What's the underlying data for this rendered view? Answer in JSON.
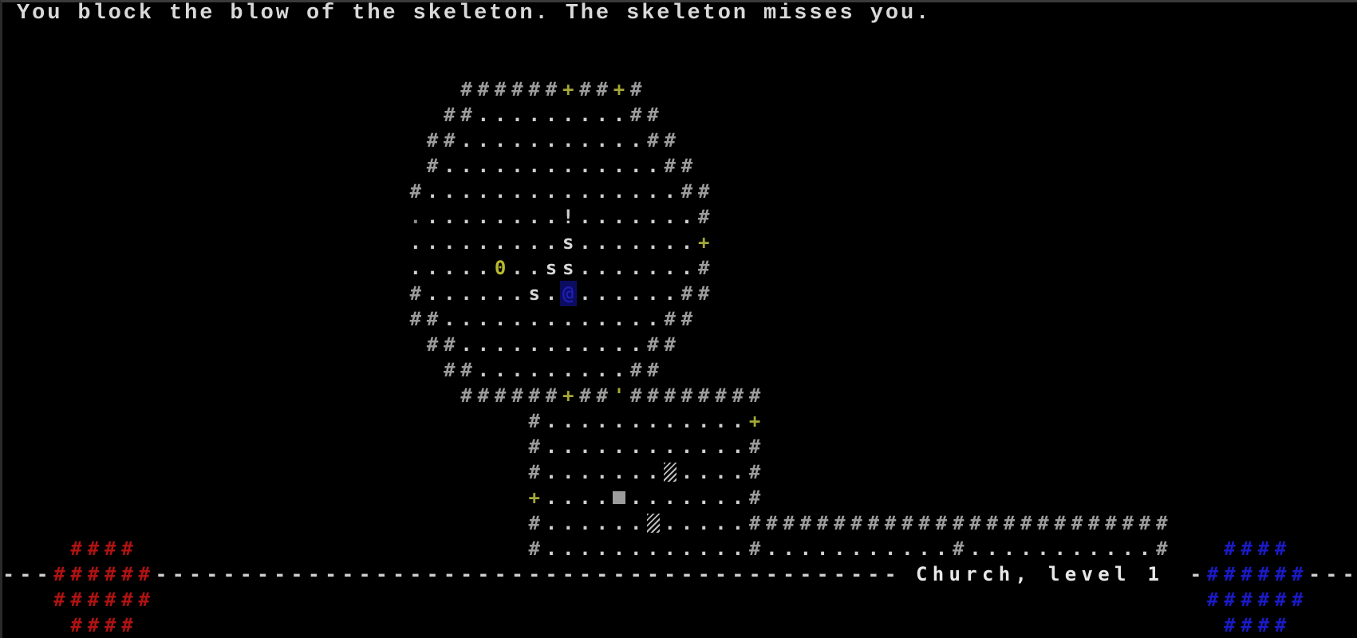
{
  "game": {
    "title": "Church, level 1",
    "message": "You block the blow of the skeleton. The skeleton misses you."
  },
  "legend": {
    "#": {
      "name": "wall",
      "color": "#9c9c9c"
    },
    ".": {
      "name": "floor",
      "color": "#cfcfcf"
    },
    "+": {
      "name": "door-closed",
      "color": "#a4a838"
    },
    "'": {
      "name": "door-open",
      "color": "#a4a838"
    },
    "!": {
      "name": "potion",
      "color": "#cfcfcf"
    },
    "0": {
      "name": "item-zero",
      "color": "#b8b830"
    },
    "s": {
      "name": "skeleton",
      "color": "#d8d8d8"
    },
    "@": {
      "name": "player",
      "color": "#1e1eb4"
    },
    "%": {
      "name": "hatched-tile",
      "color": "#bdbdbd"
    },
    "=": {
      "name": "gray-block",
      "color": "#9c9c9c"
    }
  },
  "map": {
    "first_row": 3,
    "rows": [
      "                           ######+##+#",
      "                          ##.........##",
      "                         ##...........##",
      "                         #.............##",
      "                        #...............##",
      "                        .........!.......#",
      "                        .........s.......+",
      "                        .....0..ss.......#",
      "                        #......s.@......##",
      "                        ##.............##",
      "                         ##...........##",
      "                          ##.........##",
      "                           ######+##'########",
      "                               #............+",
      "                               #............#",
      "                               #.......%....#",
      "                               +....=.......#",
      "                               #......%.....#########################",
      "                               #............#...........#...........#"
    ],
    "dim_floor": [
      [
        8,
        24
      ]
    ]
  },
  "status_bar": {
    "row": 22,
    "location": "Church, level 1",
    "location_col": 54,
    "dash_ranges": [
      [
        0,
        2
      ],
      [
        9,
        52
      ],
      [
        70,
        70
      ],
      [
        77,
        79
      ]
    ]
  },
  "health_orb": {
    "label": "health",
    "color": "#b01212",
    "rows": [
      {
        "row": 21,
        "from": 4,
        "to": 7
      },
      {
        "row": 22,
        "from": 3,
        "to": 8
      },
      {
        "row": 23,
        "from": 3,
        "to": 8
      },
      {
        "row": 24,
        "from": 4,
        "to": 7
      }
    ]
  },
  "mana_orb": {
    "label": "mana",
    "color": "#1a1ac8",
    "rows": [
      {
        "row": 21,
        "from": 72,
        "to": 75
      },
      {
        "row": 22,
        "from": 71,
        "to": 76
      },
      {
        "row": 23,
        "from": 71,
        "to": 76
      },
      {
        "row": 24,
        "from": 72,
        "to": 75
      }
    ]
  }
}
